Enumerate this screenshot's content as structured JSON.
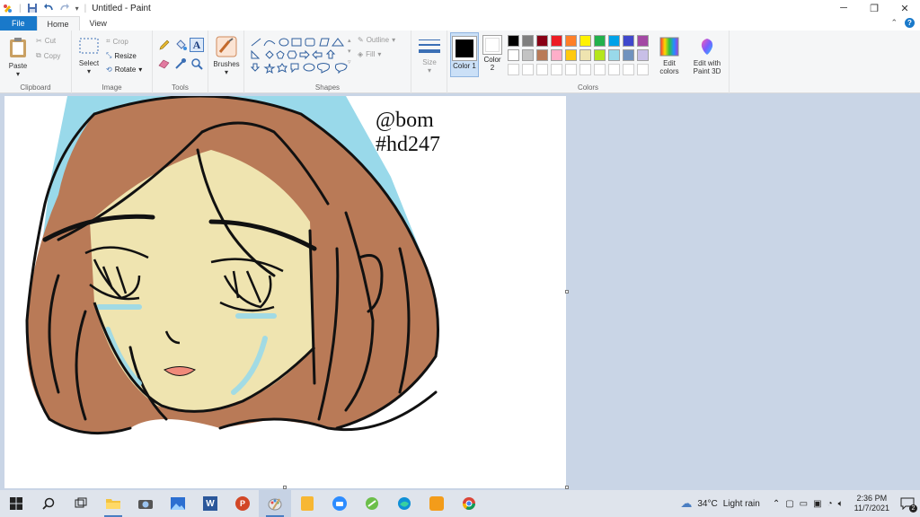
{
  "window": {
    "title": "Untitled - Paint"
  },
  "tabs": [
    {
      "label": "File"
    },
    {
      "label": "Home"
    },
    {
      "label": "View"
    }
  ],
  "ribbon": {
    "clipboard": {
      "paste": "Paste",
      "cut": "Cut",
      "copy": "Copy",
      "group": "Clipboard"
    },
    "image": {
      "select": "Select",
      "crop": "Crop",
      "resize": "Resize",
      "rotate": "Rotate",
      "group": "Image"
    },
    "tools": {
      "group": "Tools"
    },
    "brushes": {
      "label": "Brushes"
    },
    "shapes": {
      "outline": "Outline",
      "fill": "Fill",
      "group": "Shapes"
    },
    "size": {
      "label": "Size"
    },
    "colors": {
      "color1": "Color 1",
      "color1_num": "1",
      "color2": "Color",
      "color2_num": "2",
      "edit_colors_1": "Edit",
      "edit_colors_2": "colors",
      "paint3d_1": "Edit with",
      "paint3d_2": "Paint 3D",
      "group": "Colors",
      "color1_value": "#000000",
      "color2_value": "#ffffff",
      "palette_row1": [
        "#000000",
        "#7f7f7f",
        "#880015",
        "#ed1c24",
        "#ff7f27",
        "#fff200",
        "#22b14c",
        "#00a2e8",
        "#3f48cc",
        "#a349a4"
      ],
      "palette_row2": [
        "#ffffff",
        "#c3c3c3",
        "#b97a57",
        "#ffaec9",
        "#ffc90e",
        "#efe4b0",
        "#b5e61d",
        "#99d9ea",
        "#7092be",
        "#c8bfe7"
      ]
    }
  },
  "canvas": {
    "signature_line1": "@bom",
    "signature_line2": "#hd247"
  },
  "taskbar": {
    "weather_temp": "34°C",
    "weather_desc": "Light rain",
    "time": "2:36 PM",
    "date": "11/7/2021",
    "notifications": "2"
  }
}
